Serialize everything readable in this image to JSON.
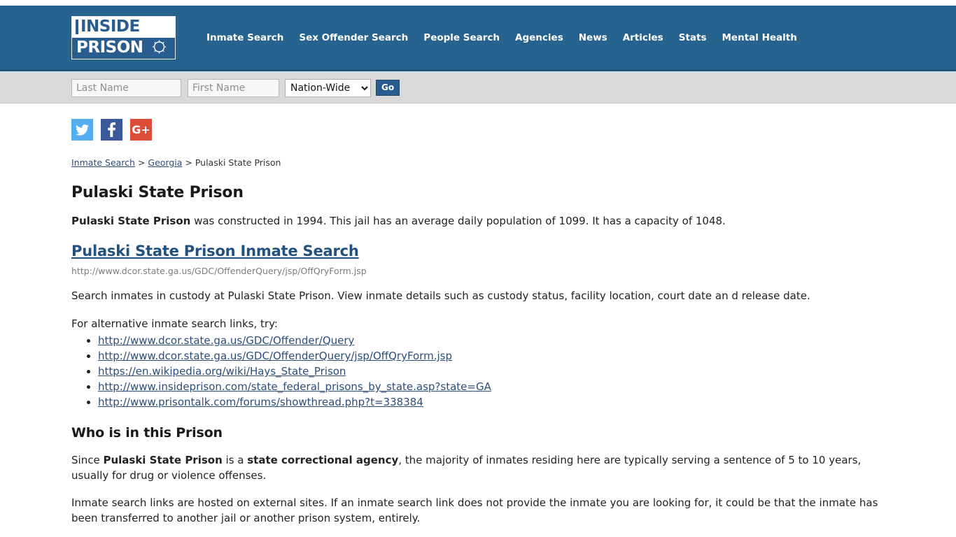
{
  "header": {
    "logo": {
      "line1": "INSIDE",
      "line2": "PRISON",
      "icon": "barbed-wire-circle-icon"
    },
    "nav": [
      {
        "label": "Inmate Search"
      },
      {
        "label": "Sex Offender Search"
      },
      {
        "label": "People Search"
      },
      {
        "label": "Agencies"
      },
      {
        "label": "News"
      },
      {
        "label": "Articles"
      },
      {
        "label": "Stats"
      },
      {
        "label": "Mental Health"
      }
    ],
    "colors": {
      "header_blue": "#26638f",
      "logo_blue": "#2a5d8f",
      "search_band": "#d9d9d9"
    }
  },
  "search": {
    "last_name_placeholder": "Last Name",
    "last_name_value": "",
    "first_name_placeholder": "First Name",
    "first_name_value": "",
    "scope_selected": "Nation-Wide",
    "scope_options": [
      "Nation-Wide"
    ],
    "go_label": "Go"
  },
  "social": [
    {
      "name": "twitter",
      "label": "Twitter",
      "color": "#55acee"
    },
    {
      "name": "facebook",
      "label": "Facebook",
      "color": "#3b5998"
    },
    {
      "name": "google-plus",
      "label": "Google Plus",
      "glyph": "G+",
      "color": "#dd4b39"
    }
  ],
  "breadcrumb": {
    "item1": "Inmate Search",
    "sep1": " > ",
    "item2": "Georgia",
    "sep2": " > ",
    "item3": "Pulaski State Prison"
  },
  "main": {
    "page_title": "Pulaski State Prison",
    "intro_bold": "Pulaski State Prison",
    "intro_rest": " was constructed in 1994. This jail has an average daily population of 1099. It has a capacity of 1048.",
    "inmate_search_heading": "Pulaski State Prison Inmate Search",
    "inmate_search_url": "http://www.dcor.state.ga.us/GDC/OffenderQuery/jsp/OffQryForm.jsp",
    "description": "Search inmates in custody at Pulaski State Prison. View inmate details such as custody status, facility location, court date an d release date.",
    "alt_links_intro": "For alternative inmate search links, try:",
    "alt_links": [
      "http://www.dcor.state.ga.us/GDC/Offender/Query",
      "http://www.dcor.state.ga.us/GDC/OffenderQuery/jsp/OffQryForm.jsp",
      "https://en.wikipedia.org/wiki/Hays_State_Prison",
      "http://www.insideprison.com/state_federal_prisons_by_state.asp?state=GA",
      "http://www.prisontalk.com/forums/showthread.php?t=338384"
    ],
    "who_heading": "Who is in this Prison",
    "who_p1_a": "Since ",
    "who_p1_b": "Pulaski State Prison",
    "who_p1_c": " is a ",
    "who_p1_d": "state correctional agency",
    "who_p1_e": ", the majority of inmates residing here are typically serving a sentence of 5 to 10 years, usually for drug or violence offenses.",
    "who_p2": "Inmate search links are hosted on external sites. If an inmate search link does not provide the inmate you are looking for, it could be that the inmate has been transferred to another jail or another prison system, entirely."
  }
}
